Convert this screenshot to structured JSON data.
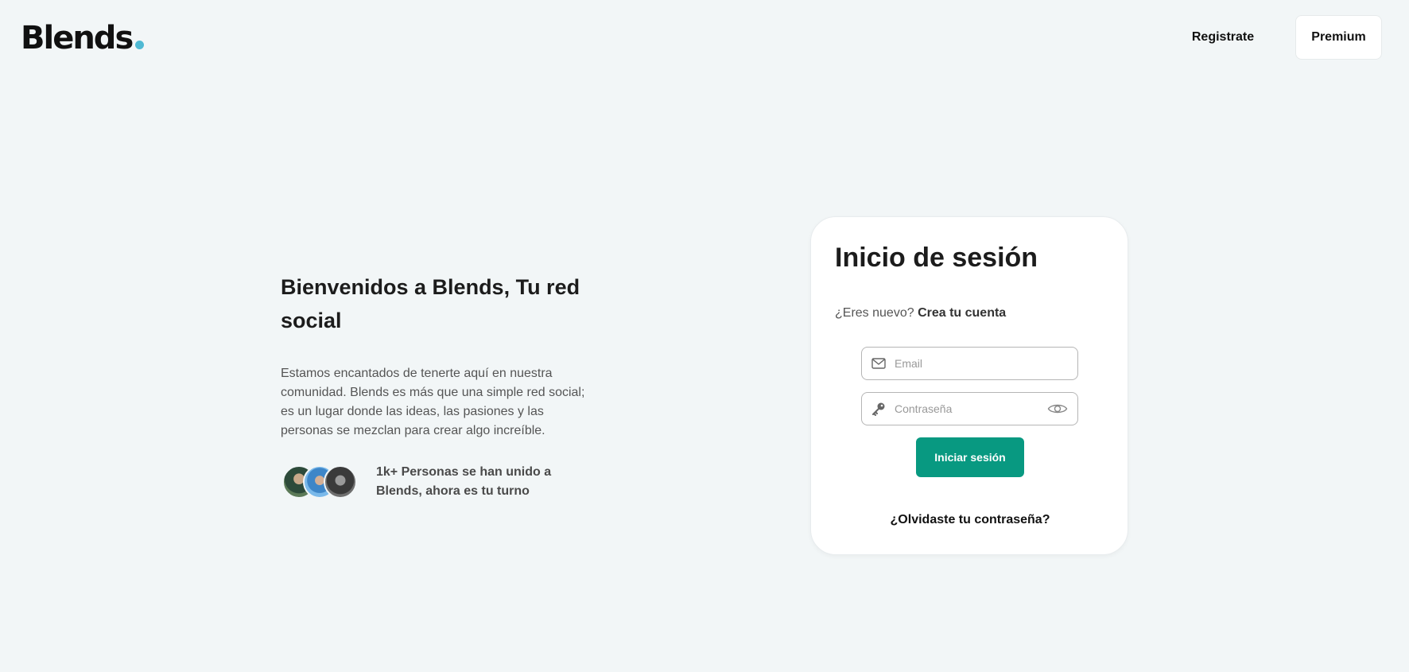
{
  "header": {
    "logo_text": "Blends",
    "logo_dot_color": "#4fb9d3",
    "register_label": "Registrate",
    "premium_label": "Premium"
  },
  "hero": {
    "title": "Bienvenidos a Blends, Tu red social",
    "description": "Estamos encantados de tenerte aquí en nuestra comunidad. Blends es más que una simple red social; es un lugar donde las ideas, las pasiones y las personas se mezclan para crear algo increíble.",
    "social_proof": "1k+ Personas se han unido a Blends, ahora es tu turno",
    "avatars": [
      "user-avatar-1",
      "user-avatar-2",
      "user-avatar-3"
    ]
  },
  "login": {
    "title": "Inicio de sesión",
    "signup_prompt": "¿Eres nuevo?",
    "signup_link": "Crea tu cuenta",
    "email_value": "",
    "email_placeholder": "Email",
    "email_icon": "mail-icon",
    "password_value": "",
    "password_placeholder": "Contraseña",
    "password_icon": "key-icon",
    "toggle_icon": "eye-icon",
    "submit_label": "Iniciar sesión",
    "forgot_label": "¿Olvidaste tu contraseña?",
    "accent_color": "#089981"
  }
}
